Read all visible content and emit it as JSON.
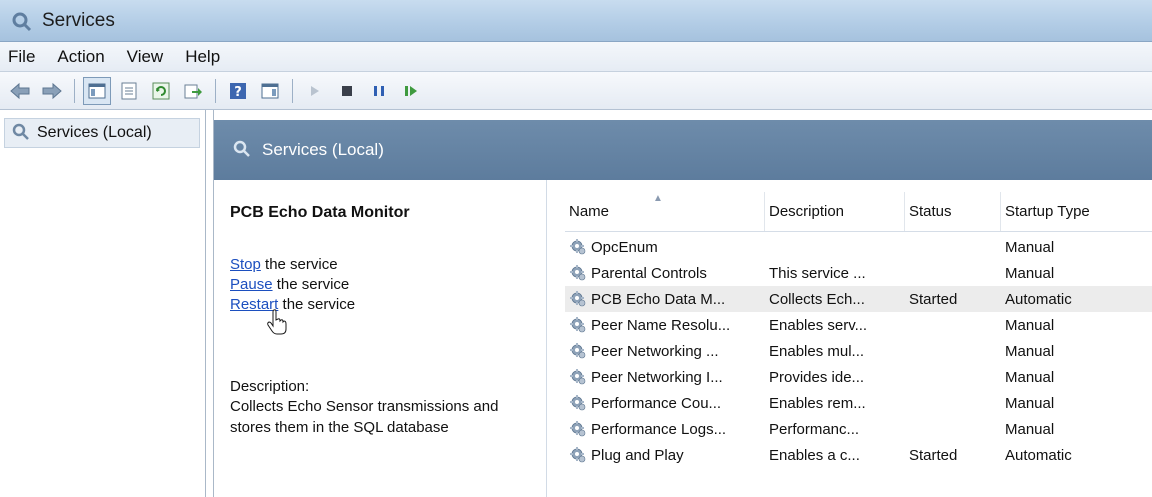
{
  "window": {
    "title": "Services"
  },
  "menu": [
    "File",
    "Action",
    "View",
    "Help"
  ],
  "tree": {
    "root_label": "Services (Local)"
  },
  "header": {
    "title": "Services (Local)"
  },
  "details": {
    "service_name": "PCB Echo Data Monitor",
    "actions": [
      {
        "link": "Stop",
        "rest": " the service"
      },
      {
        "link": "Pause",
        "rest": " the service"
      },
      {
        "link": "Restart",
        "rest": " the service"
      }
    ],
    "description_label": "Description:",
    "description_text": "Collects Echo Sensor transmissions and stores them in the SQL database"
  },
  "table": {
    "columns": [
      "Name",
      "Description",
      "Status",
      "Startup Type"
    ],
    "rows": [
      {
        "name": "OpcEnum",
        "description": "",
        "status": "",
        "startup": "Manual"
      },
      {
        "name": "Parental Controls",
        "description": "This service ...",
        "status": "",
        "startup": "Manual"
      },
      {
        "name": "PCB Echo Data M...",
        "description": "Collects Ech...",
        "status": "Started",
        "startup": "Automatic",
        "selected": true
      },
      {
        "name": "Peer Name Resolu...",
        "description": "Enables serv...",
        "status": "",
        "startup": "Manual"
      },
      {
        "name": "Peer Networking ...",
        "description": "Enables mul...",
        "status": "",
        "startup": "Manual"
      },
      {
        "name": "Peer Networking I...",
        "description": "Provides ide...",
        "status": "",
        "startup": "Manual"
      },
      {
        "name": "Performance Cou...",
        "description": "Enables rem...",
        "status": "",
        "startup": "Manual"
      },
      {
        "name": "Performance Logs...",
        "description": "Performanc...",
        "status": "",
        "startup": "Manual"
      },
      {
        "name": "Plug and Play",
        "description": "Enables a c...",
        "status": "Started",
        "startup": "Automatic"
      }
    ]
  },
  "colors": {
    "header_bg": "#6e8cab",
    "link": "#1c4fbf",
    "selected_row": "#ececec"
  }
}
